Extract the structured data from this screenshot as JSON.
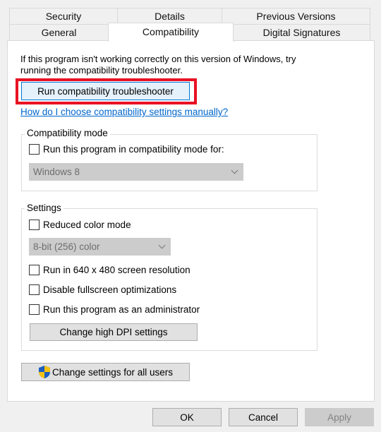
{
  "tabs": {
    "row1": [
      "Security",
      "Details",
      "Previous Versions"
    ],
    "row2": [
      "General",
      "Compatibility",
      "Digital Signatures"
    ],
    "selected": "Compatibility"
  },
  "intro": {
    "line1": "If this program isn't working correctly on this version of Windows, try",
    "line2": "running the compatibility troubleshooter."
  },
  "troubleshooter_button": "Run compatibility troubleshooter",
  "help_link": "How do I choose compatibility settings manually?",
  "compat_mode": {
    "label": "Compatibility mode",
    "checkbox": "Run this program in compatibility mode for:",
    "checked": false,
    "select_value": "Windows 8"
  },
  "settings": {
    "label": "Settings",
    "reduced_color": "Reduced color mode",
    "color_select": "8-bit (256) color",
    "res": "Run in 640 x 480 screen resolution",
    "fullscreen": "Disable fullscreen optimizations",
    "admin": "Run this program as an administrator",
    "dpi_button": "Change high DPI settings"
  },
  "all_users_button": "Change settings for all users",
  "footer": {
    "ok": "OK",
    "cancel": "Cancel",
    "apply": "Apply"
  },
  "colors": {
    "highlight": "#e81123",
    "link": "#0066cc",
    "shield_blue": "#1e5fbf",
    "shield_yellow": "#f5c211"
  }
}
